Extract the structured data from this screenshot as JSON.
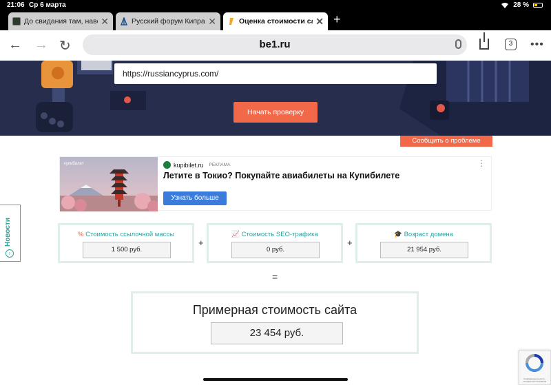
{
  "status_bar": {
    "time": "21:06",
    "date": "Ср 6 марта",
    "battery": "28 %"
  },
  "tabs": [
    {
      "label": "До свидания там, наве",
      "favicon_color": "#2b3a2b"
    },
    {
      "label": "Русский форум Кипра",
      "favicon_color": "#1a4d8c"
    },
    {
      "label": "Оценка стоимости сай",
      "favicon_color": "#f5a623"
    }
  ],
  "address_bar": {
    "domain": "be1.ru",
    "tab_count": "3"
  },
  "hero": {
    "input_value": "https://russiancyprus.com/",
    "check_button": "Начать проверку",
    "report_button": "Сообщить о проблеме"
  },
  "ad": {
    "image_caption": "купибилет",
    "brand": "kupibilet.ru",
    "tag": "РЕКЛАМА",
    "title": "Летите в Токио? Покупайте авиабилеты на Купибилете",
    "button": "Узнать больше"
  },
  "news_tab": {
    "label": "Новости"
  },
  "metrics": [
    {
      "label": "Стоимость ссылочной массы",
      "value": "1 500 руб.",
      "icon": "link-icon"
    },
    {
      "label": "Стоимость SEO-трафика",
      "value": "0 руб.",
      "icon": "chart-icon"
    },
    {
      "label": "Возраст домена",
      "value": "21 954 руб.",
      "icon": "graduation-cap-icon"
    }
  ],
  "operators": {
    "plus": "+",
    "equals": "="
  },
  "total": {
    "label": "Примерная стоимость сайта",
    "value": "23 454 руб."
  },
  "recaptcha": {
    "text": "Конфиденциальность - Условия использования"
  },
  "colors": {
    "accent": "#f2694a",
    "teal": "#2aa39b",
    "hero_bg": "#262d4d",
    "ad_button": "#3a7bdc"
  }
}
